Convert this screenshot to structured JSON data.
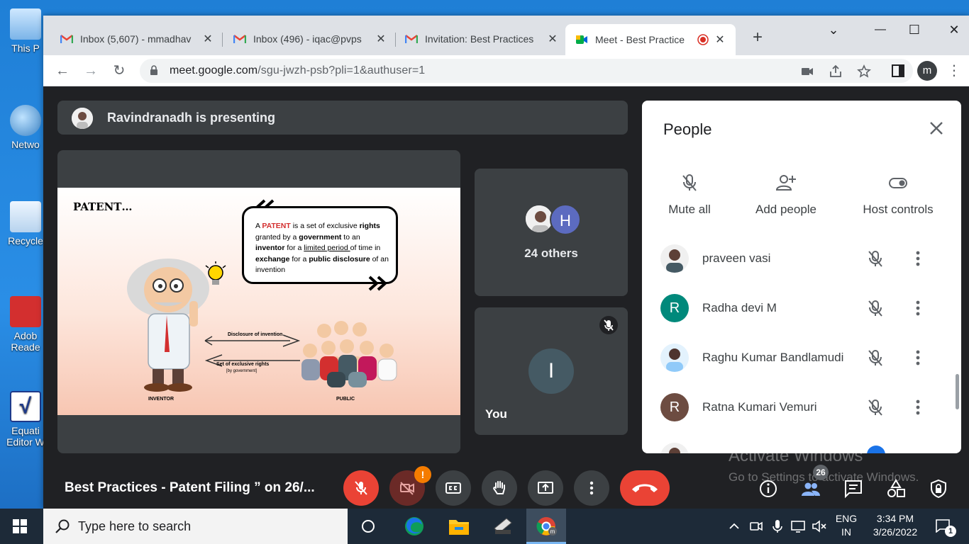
{
  "desktop": {
    "icons": [
      {
        "label": "This P"
      },
      {
        "label": "Netwo"
      },
      {
        "label": "Recycle"
      },
      {
        "label": "Adob Reade"
      },
      {
        "label": "Equati Editor W"
      }
    ]
  },
  "tabs": [
    {
      "title": "Inbox (5,607) - mmadhav",
      "close": "✕"
    },
    {
      "title": "Inbox (496) - iqac@pvps",
      "close": "✕"
    },
    {
      "title": "Invitation: Best Practices",
      "close": "✕"
    },
    {
      "title": "Meet - Best Practice",
      "close": "✕"
    }
  ],
  "address": {
    "host": "meet.google.com",
    "path": "/sgu-jwzh-psb?pli=1&authuser=1"
  },
  "profile_initial": "m",
  "presenting": {
    "text": "Ravindranadh is presenting"
  },
  "slide": {
    "title": "PATENT…",
    "p1": "A ",
    "p_patent": "PATENT",
    "p2": " is a set of exclusive ",
    "p_rights": "rights",
    "p3": " granted by a ",
    "p_gov": "government",
    "p4": " to an ",
    "p_inventor": "inventor",
    "p5": " for a ",
    "p_limited": "limited period ",
    "p6": "of time in ",
    "p_exchange": "exchange",
    "p7": " for a ",
    "p_public": "public disclosure",
    "p8": " of an invention",
    "arrow1": "Disclosure of invention",
    "arrow2": "Set of exclusive rights",
    "arrow2b": "[by government]",
    "inventor": "INVENTOR",
    "public": "PUBLIC"
  },
  "tiles": {
    "others_initial": "H",
    "others_label": "24 others",
    "you_initial": "I",
    "you_label": "You"
  },
  "people": {
    "header": "People",
    "actions": {
      "mute_all": "Mute all",
      "add_people": "Add people",
      "host_controls": "Host controls"
    },
    "list": [
      {
        "name": "praveen vasi",
        "initial": "",
        "color": "#6d4c41"
      },
      {
        "name": "Radha devi M",
        "initial": "R",
        "color": "#00897b"
      },
      {
        "name": "Raghu Kumar Bandlamudi",
        "initial": "",
        "color": "#8d6e63"
      },
      {
        "name": "Ratna Kumari Vemuri",
        "initial": "R",
        "color": "#6d4c41"
      }
    ]
  },
  "watermark": {
    "line1": "Activate Windows",
    "line2": "Go to Settings to activate Windows."
  },
  "meeting": {
    "name": "Best Practices - Patent Filing ” on 26/...",
    "camera_badge": "!",
    "participant_count": "26"
  },
  "taskbar": {
    "search_placeholder": "Type here to search",
    "lang1": "ENG",
    "lang2": "IN",
    "time": "3:34 PM",
    "date": "3/26/2022",
    "notif_count": "1"
  },
  "colors": {
    "meet_bg": "#202124",
    "red": "#ea4335",
    "panel": "#3c4043"
  }
}
